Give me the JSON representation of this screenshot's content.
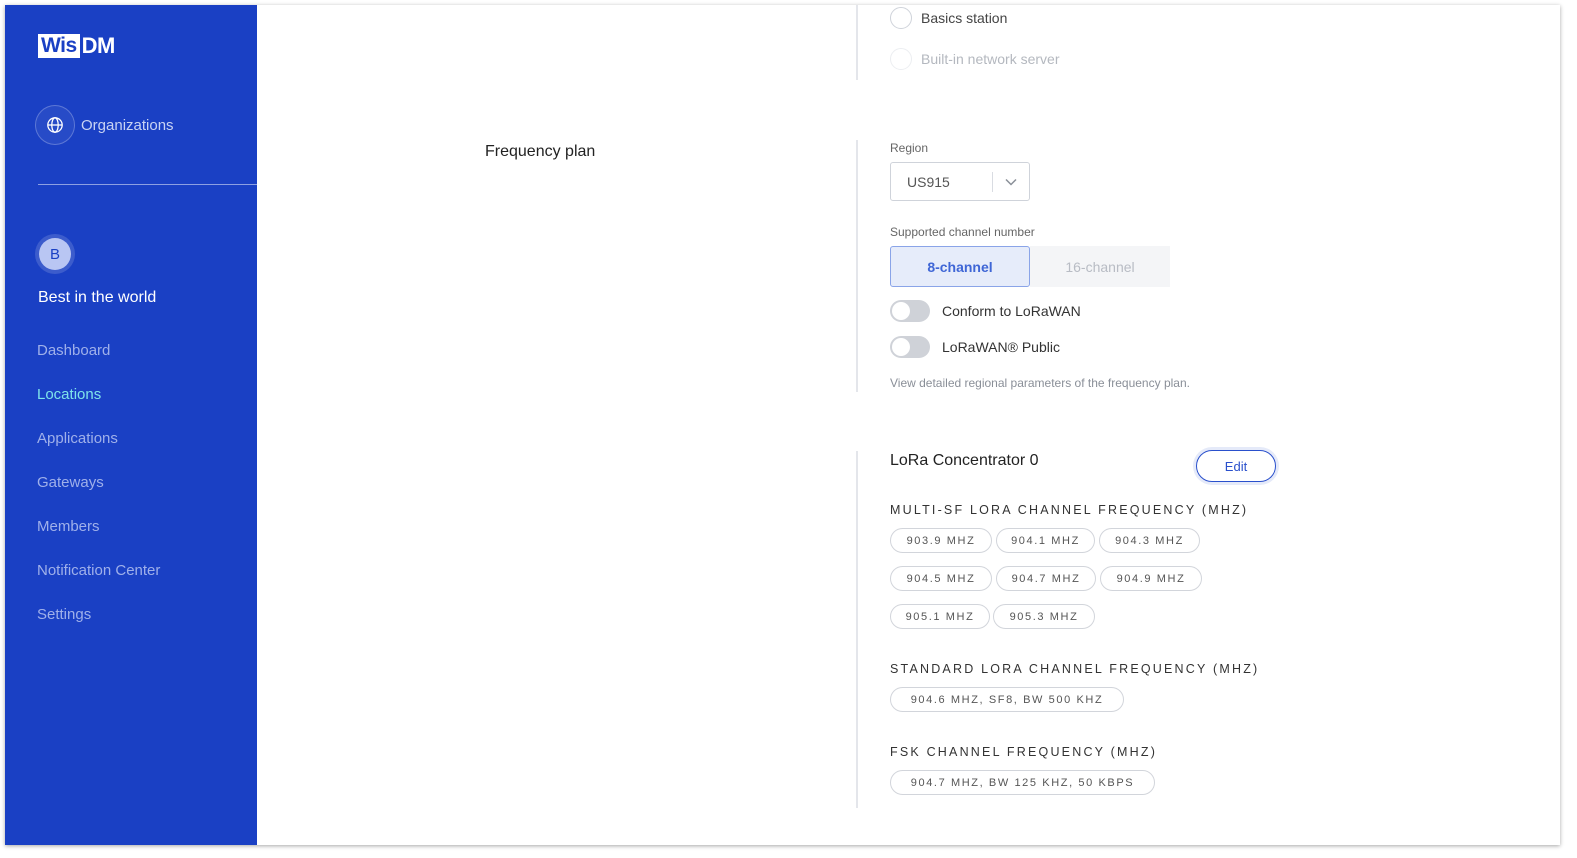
{
  "app": {
    "logo_part1": "Wis",
    "logo_part2": "DM"
  },
  "sidebar": {
    "organizations_label": "Organizations",
    "avatar_initial": "B",
    "org_name": "Best in the world",
    "nav": [
      {
        "label": "Dashboard",
        "active": false
      },
      {
        "label": "Locations",
        "active": true
      },
      {
        "label": "Applications",
        "active": false
      },
      {
        "label": "Gateways",
        "active": false
      },
      {
        "label": "Members",
        "active": false
      },
      {
        "label": "Notification Center",
        "active": false
      },
      {
        "label": "Settings",
        "active": false
      }
    ]
  },
  "work_mode": {
    "options": [
      {
        "label": "Basics station",
        "disabled": false
      },
      {
        "label": "Built-in network server",
        "disabled": true
      }
    ]
  },
  "frequency_plan": {
    "title": "Frequency plan",
    "region_label": "Region",
    "region_value": "US915",
    "channel_label": "Supported channel number",
    "channel_options": [
      "8-channel",
      "16-channel"
    ],
    "selected_channel": "8-channel",
    "toggles": [
      {
        "label": "Conform to LoRaWAN",
        "on": false
      },
      {
        "label": "LoRaWAN® Public",
        "on": false
      }
    ],
    "hint": "View detailed regional parameters of the frequency plan."
  },
  "concentrator": {
    "title": "LoRa Concentrator 0",
    "edit_label": "Edit",
    "multi_sf_heading": "Multi-SF LoRa channel frequency (MHz)",
    "multi_sf_channels": [
      "903.9 MHz",
      "904.1 MHz",
      "904.3 MHz",
      "904.5 MHz",
      "904.7 MHz",
      "904.9 MHz",
      "905.1 MHz",
      "905.3 MHz"
    ],
    "standard_heading": "Standard LoRa channel frequency (MHz)",
    "standard_channel": "904.6 MHz, SF8, BW 500 kHz",
    "fsk_heading": "FSK channel frequency (MHz)",
    "fsk_channel": "904.7 MHz, BW 125 kHz, 50 kbps"
  },
  "colors": {
    "sidebar_bg": "#1a40c4",
    "active_nav": "#7fe3ea",
    "accent": "#2a50cc"
  }
}
